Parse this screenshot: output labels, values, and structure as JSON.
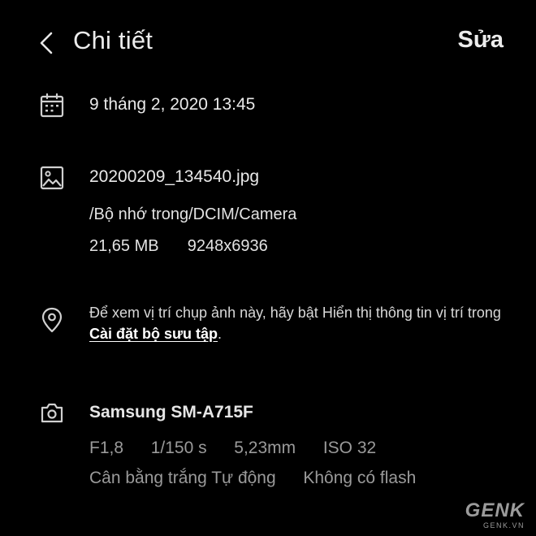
{
  "header": {
    "title": "Chi tiết",
    "edit_label": "Sửa"
  },
  "date_section": {
    "icon": "calendar-icon",
    "datetime": "9 tháng 2, 2020 13:45"
  },
  "file_section": {
    "icon": "image-icon",
    "filename": "20200209_134540.jpg",
    "path": "/Bộ nhớ trong/DCIM/Camera",
    "size": "21,65 MB",
    "resolution": "9248x6936"
  },
  "location_section": {
    "icon": "location-pin-icon",
    "message_prefix": "Để xem vị trí chụp ảnh này, hãy bật Hiển thị thông tin vị trí trong ",
    "settings_link": "Cài đặt bộ sưu tập",
    "message_suffix": "."
  },
  "camera_section": {
    "icon": "camera-icon",
    "model": "Samsung SM-A715F",
    "aperture": "F1,8",
    "shutter": "1/150 s",
    "focal_length": "5,23mm",
    "iso": "ISO 32",
    "white_balance": "Cân bằng trắng Tự động",
    "flash": "Không có flash"
  },
  "watermark": {
    "logo": "GENK",
    "site": "GENK.VN"
  }
}
